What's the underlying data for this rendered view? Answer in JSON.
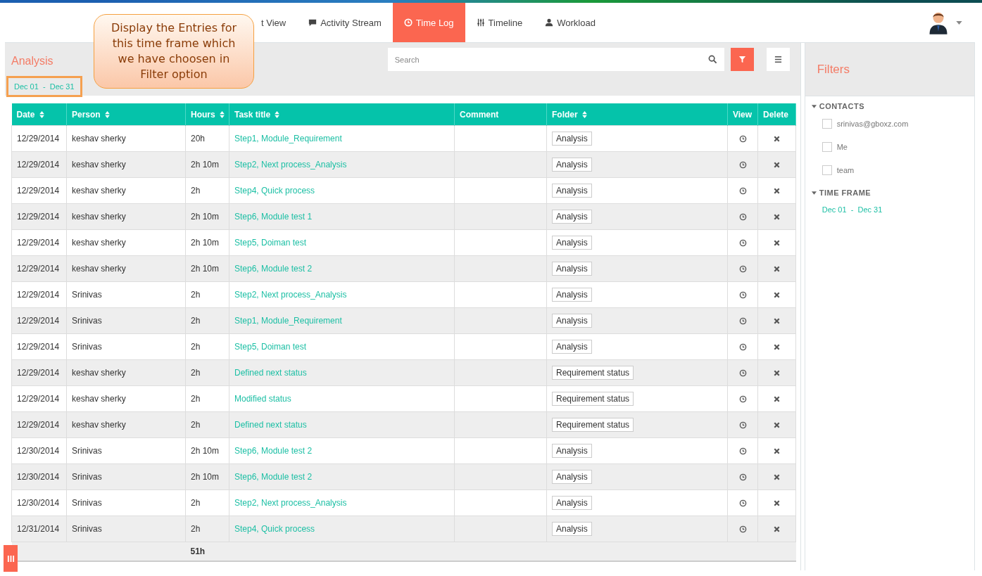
{
  "nav": {
    "tabs": [
      {
        "label": "t View",
        "selected": false
      },
      {
        "label": "Activity Stream",
        "selected": false
      },
      {
        "label": "Time Log",
        "selected": true
      },
      {
        "label": "Timeline",
        "selected": false
      },
      {
        "label": "Workload",
        "selected": false
      }
    ]
  },
  "callout": {
    "text": "Display the Entries for this time frame which we have choosen in Filter option"
  },
  "panel": {
    "title": "Analysis",
    "date_range": "Dec 01  -  Dec 31",
    "search": {
      "placeholder": "Search"
    }
  },
  "table": {
    "columns": [
      {
        "label": "Date",
        "sortable": true
      },
      {
        "label": "Person",
        "sortable": true
      },
      {
        "label": "Hours",
        "sortable": true
      },
      {
        "label": "Task title",
        "sortable": true
      },
      {
        "label": "Comment",
        "sortable": false
      },
      {
        "label": "Folder",
        "sortable": true
      },
      {
        "label": "View",
        "sortable": false
      },
      {
        "label": "Delete",
        "sortable": false
      }
    ],
    "rows": [
      {
        "date": "12/29/2014",
        "person": "keshav sherky",
        "hours": "20h",
        "task": "Step1, Module_Requirement",
        "folder": "Analysis"
      },
      {
        "date": "12/29/2014",
        "person": "keshav sherky",
        "hours": "2h 10m",
        "task": "Step2, Next process_Analysis",
        "folder": "Analysis"
      },
      {
        "date": "12/29/2014",
        "person": "keshav sherky",
        "hours": "2h",
        "task": "Step4, Quick process",
        "folder": "Analysis"
      },
      {
        "date": "12/29/2014",
        "person": "keshav sherky",
        "hours": "2h 10m",
        "task": "Step6, Module test 1",
        "folder": "Analysis"
      },
      {
        "date": "12/29/2014",
        "person": "keshav sherky",
        "hours": "2h 10m",
        "task": "Step5, Doiman test",
        "folder": "Analysis"
      },
      {
        "date": "12/29/2014",
        "person": "keshav sherky",
        "hours": "2h 10m",
        "task": "Step6, Module test 2",
        "folder": "Analysis"
      },
      {
        "date": "12/29/2014",
        "person": "Srinivas",
        "hours": "2h",
        "task": "Step2, Next process_Analysis",
        "folder": "Analysis"
      },
      {
        "date": "12/29/2014",
        "person": "Srinivas",
        "hours": "2h",
        "task": "Step1, Module_Requirement",
        "folder": "Analysis"
      },
      {
        "date": "12/29/2014",
        "person": "Srinivas",
        "hours": "2h",
        "task": "Step5, Doiman test",
        "folder": "Analysis"
      },
      {
        "date": "12/29/2014",
        "person": "keshav sherky",
        "hours": "2h",
        "task": "Defined next status",
        "folder": "Requirement status"
      },
      {
        "date": "12/29/2014",
        "person": "keshav sherky",
        "hours": "2h",
        "task": "Modified status",
        "folder": "Requirement status"
      },
      {
        "date": "12/29/2014",
        "person": "keshav sherky",
        "hours": "2h",
        "task": "Defined next status",
        "folder": "Requirement status"
      },
      {
        "date": "12/30/2014",
        "person": "Srinivas",
        "hours": "2h 10m",
        "task": "Step6, Module test 2",
        "folder": "Analysis"
      },
      {
        "date": "12/30/2014",
        "person": "Srinivas",
        "hours": "2h 10m",
        "task": "Step6, Module test 2",
        "folder": "Analysis"
      },
      {
        "date": "12/30/2014",
        "person": "Srinivas",
        "hours": "2h",
        "task": "Step2, Next process_Analysis",
        "folder": "Analysis"
      },
      {
        "date": "12/31/2014",
        "person": "Srinivas",
        "hours": "2h",
        "task": "Step4, Quick process",
        "folder": "Analysis"
      }
    ],
    "total": "51h"
  },
  "filters": {
    "title": "Filters",
    "contacts": {
      "heading": "CONTACTS",
      "items": [
        {
          "label": "srinivas@gboxz.com",
          "checked": false
        },
        {
          "label": "Me",
          "checked": false
        },
        {
          "label": "team",
          "checked": false
        }
      ]
    },
    "time_frame": {
      "heading": "TIME FRAME",
      "range": "Dec 01  -  Dec 31"
    }
  }
}
